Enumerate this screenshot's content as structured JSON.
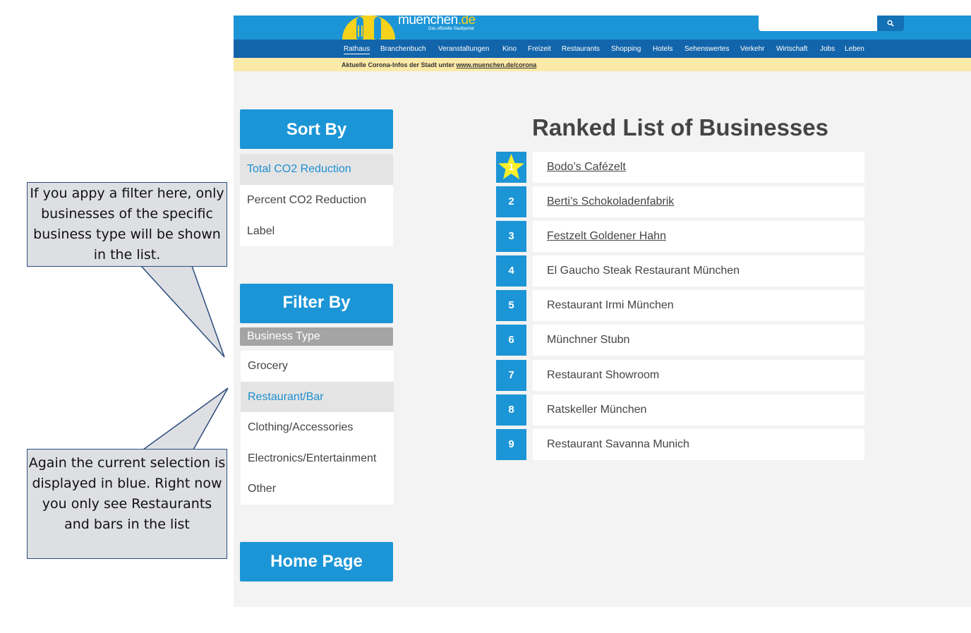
{
  "header": {
    "logo_text": "muenchen",
    "logo_tld": ".de",
    "logo_subtitle": "Das offizielle Stadtportal",
    "search_icon": "search-icon",
    "nav": [
      "Rathaus",
      "Branchenbuch",
      "Veranstaltungen",
      "Kino",
      "Freizeit",
      "Restaurants",
      "Shopping",
      "Hotels",
      "Sehenswertes",
      "Verkehr",
      "Wirtschaft",
      "Jobs",
      "Leben"
    ],
    "active_nav": "Rathaus",
    "info_text": "Aktuelle Corona-Infos der Stadt unter ",
    "info_link": "www.muenchen.de/corona"
  },
  "sort": {
    "title": "Sort By",
    "options": [
      "Total CO2 Reduction",
      "Percent CO2 Reduction",
      "Label"
    ],
    "selected": "Total CO2 Reduction"
  },
  "filter": {
    "title": "Filter By",
    "subheader": "Business Type",
    "options": [
      "Grocery",
      "Restaurant/Bar",
      "Clothing/Accessories",
      "Electronics/Entertainment",
      "Other"
    ],
    "selected": "Restaurant/Bar"
  },
  "home_button": "Home Page",
  "ranked_list": {
    "title": "Ranked List of Businesses",
    "top_icon": "star-icon",
    "items": [
      {
        "rank": "1",
        "name": "Bodo’s Cafézelt"
      },
      {
        "rank": "2",
        "name": "Berti’s Schokoladenfabrik"
      },
      {
        "rank": "3",
        "name": "Festzelt Goldener Hahn"
      },
      {
        "rank": "4",
        "name": "El Gaucho Steak Restaurant München"
      },
      {
        "rank": "5",
        "name": "Restaurant Irmi München"
      },
      {
        "rank": "6",
        "name": "Münchner Stubn"
      },
      {
        "rank": "7",
        "name": "Restaurant Showroom"
      },
      {
        "rank": "8",
        "name": "Ratskeller München"
      },
      {
        "rank": "9",
        "name": "Restaurant Savanna Munich"
      }
    ]
  },
  "callouts": {
    "filter_note": "If you appy a filter here, only businesses of the specific business type will be shown in the list.",
    "selection_note": "Again the current selection is displayed in blue. Right now you only see Restaurants and bars in the list"
  },
  "colors": {
    "primary_blue": "#1c95d6",
    "nav_blue": "#1365ab",
    "selected_text": "#1f8fd0",
    "logo_yellow": "#f7d21c",
    "callout_bg": "#dedfe3",
    "callout_border": "#2b4d7e"
  }
}
